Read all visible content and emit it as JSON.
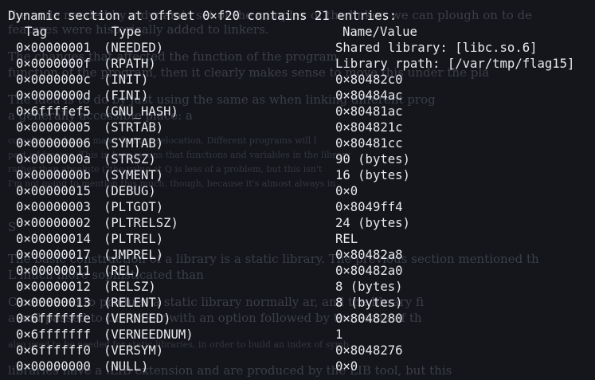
{
  "title": "Dynamic section at offset 0×f20 contains 21 entries:",
  "headers": {
    "tag": "Tag",
    "type": "Type",
    "value": "Name/Value"
  },
  "entries": [
    {
      "tag": "0×00000001",
      "type": "(NEEDED)",
      "value": "Shared library: [libc.so.6]"
    },
    {
      "tag": "0×0000000f",
      "type": "(RPATH)",
      "value": "Library rpath: [/var/tmp/flag15]"
    },
    {
      "tag": "0×0000000c",
      "type": "(INIT)",
      "value": "0×80482c0"
    },
    {
      "tag": "0×0000000d",
      "type": "(FINI)",
      "value": "0×80484ac"
    },
    {
      "tag": "0×6ffffef5",
      "type": "(GNU_HASH)",
      "value": "0×80481ac"
    },
    {
      "tag": "0×00000005",
      "type": "(STRTAB)",
      "value": "0×804821c"
    },
    {
      "tag": "0×00000006",
      "type": "(SYMTAB)",
      "value": "0×80481cc"
    },
    {
      "tag": "0×0000000a",
      "type": "(STRSZ)",
      "value": "90 (bytes)"
    },
    {
      "tag": "0×0000000b",
      "type": "(SYMENT)",
      "value": "16 (bytes)"
    },
    {
      "tag": "0×00000015",
      "type": "(DEBUG)",
      "value": "0×0"
    },
    {
      "tag": "0×00000003",
      "type": "(PLTGOT)",
      "value": "0×8049ff4"
    },
    {
      "tag": "0×00000002",
      "type": "(PLTRELSZ)",
      "value": "24 (bytes)"
    },
    {
      "tag": "0×00000014",
      "type": "(PLTREL)",
      "value": "REL"
    },
    {
      "tag": "0×00000017",
      "type": "(JMPREL)",
      "value": "0×80482a8"
    },
    {
      "tag": "0×00000011",
      "type": "(REL)",
      "value": "0×80482a0"
    },
    {
      "tag": "0×00000012",
      "type": "(RELSZ)",
      "value": "8 (bytes)"
    },
    {
      "tag": "0×00000013",
      "type": "(RELENT)",
      "value": "8 (bytes)"
    },
    {
      "tag": "0×6ffffffe",
      "type": "(VERNEED)",
      "value": "0×8048280"
    },
    {
      "tag": "0×6fffffff",
      "type": "(VERNEEDNUM)",
      "value": "1"
    },
    {
      "tag": "0×6ffffff0",
      "type": "(VERSYM)",
      "value": "0×8048276"
    },
    {
      "tag": "0×00000000",
      "type": "(NULL)",
      "value": "0×0"
    }
  ],
  "background_article": {
    "lines": [
      "the code needed by a dynamic set of the complex of the linker, we can plough on to de",
      "features were historically added to linkers.",
      "The changes that affected the function of the program",
      "function of the program, then it clearly makes sense to move this under the pla",
      "The idea is to do by just using the same as when linking different prog",
      "a generally accessible place: a",
      "completely skips a major feature relocation. Different programs will l",
      "part addresses. This in turn means that functions and variables in the library",
      "rather than absolute (\"the value at Q is less of a problem, but this isn't",
      "I'm not going to mention this much, though, because it's almost always in",
      "S",
      "The basic construction of a library is a static library. The previous section mentioned th",
      "L much more sophisticated than",
      "C command to produce a static library normally ar, and the library fi",
      "a and passed to the linker with an option followed by the name of th",
      "also used to be needed for static libraries, in order to build an index of symb",
      "libraries have a .LIB extension and are produced by the LIB tool, but this"
    ]
  }
}
